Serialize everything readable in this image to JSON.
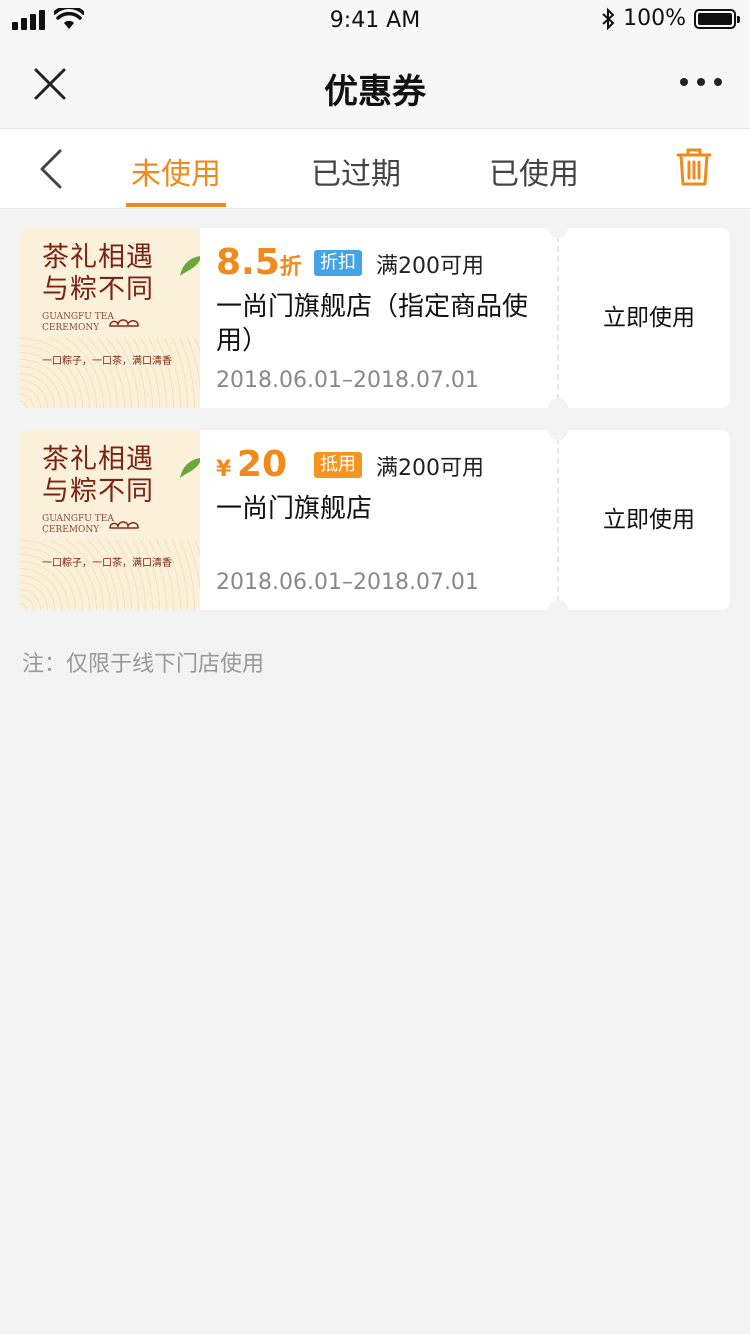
{
  "status_bar": {
    "time": "9:41 AM",
    "battery": "100%"
  },
  "nav": {
    "title": "优惠券"
  },
  "tabs": [
    {
      "label": "未使用",
      "active": true
    },
    {
      "label": "已过期",
      "active": false
    },
    {
      "label": "已使用",
      "active": false
    }
  ],
  "coupons": [
    {
      "image": {
        "title_line1": "茶礼相遇",
        "title_line2": "与粽不同",
        "sub_line1": "GUANGFU TEA",
        "sub_line2": "CEREMONY",
        "slogan": "一口粽子，一口茶，满口清香"
      },
      "amount": "8.5",
      "amount_unit": "折",
      "badge": "折扣",
      "condition": "满200可用",
      "store": "一尚门旗舰店（指定商品使用）",
      "date": "2018.06.01–2018.07.01",
      "action": "立即使用"
    },
    {
      "image": {
        "title_line1": "茶礼相遇",
        "title_line2": "与粽不同",
        "sub_line1": "GUANGFU TEA",
        "sub_line2": "CEREMONY",
        "slogan": "一口粽子，一口茶，满口清香"
      },
      "currency": "¥",
      "amount": "20",
      "badge": "抵用",
      "condition": "满200可用",
      "store": "一尚门旗舰店",
      "date": "2018.06.01–2018.07.01",
      "action": "立即使用"
    }
  ],
  "note": "注：仅限于线下门店使用",
  "colors": {
    "accent": "#f08a1c",
    "badge_discount": "#46a3e6",
    "badge_voucher": "#f5941f",
    "background": "#f3f3f3"
  }
}
